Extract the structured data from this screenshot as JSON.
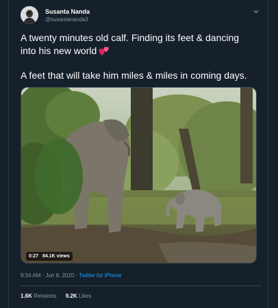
{
  "author": {
    "display_name": "Susanta Nanda",
    "handle": "@susantananda3"
  },
  "tweet": {
    "line1": "A twenty minutes old calf. Finding its feet & dancing into his new world",
    "emoji": "two-hearts-emoji",
    "line2": "A feet that will take him miles & miles in coming days."
  },
  "media": {
    "duration": "0:27",
    "views": "84.1K views"
  },
  "meta": {
    "time": "9:34 AM · Jun 8, 2020",
    "separator": " · ",
    "source": "Twitter for iPhone"
  },
  "stats": {
    "retweets_count": "1.6K",
    "retweets_label": "Retweets",
    "likes_count": "9.2K",
    "likes_label": "Likes"
  },
  "colors": {
    "background": "#15202b",
    "text": "#ffffff",
    "muted": "#8899a6",
    "accent": "#1da1f2",
    "heart": "#e0245e"
  }
}
